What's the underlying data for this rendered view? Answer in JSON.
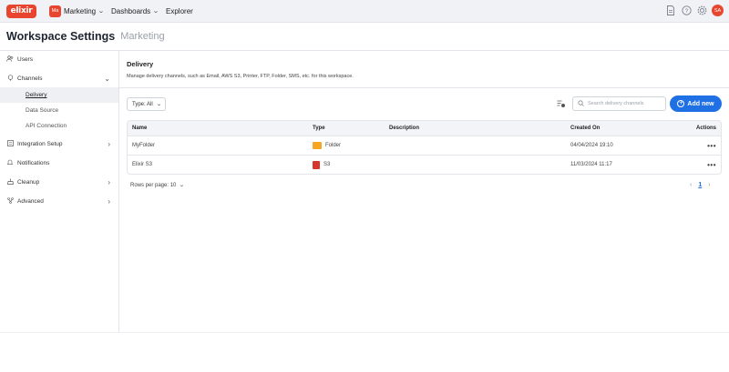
{
  "app": {
    "logo_text": "elixir",
    "brand_color": "#e8452e",
    "accent_color": "#1f6fe5"
  },
  "topbar": {
    "workspace_badge": "Ma",
    "workspace_label": "Marketing",
    "dashboards_label": "Dashboards",
    "explorer_label": "Explorer",
    "icons": [
      "report-icon",
      "help-icon",
      "settings-icon"
    ],
    "avatar_initials": "SA"
  },
  "header": {
    "title": "Workspace Settings",
    "subtitle": "Marketing"
  },
  "sidebar": {
    "items": [
      {
        "label": "Users",
        "icon": "users-icon"
      },
      {
        "label": "Channels",
        "icon": "channels-icon"
      },
      {
        "label": "Integration Setup",
        "icon": "integration-icon"
      },
      {
        "label": "Notifications",
        "icon": "bell-icon"
      },
      {
        "label": "Cleanup",
        "icon": "broom-icon"
      },
      {
        "label": "Advanced",
        "icon": "advanced-icon"
      }
    ],
    "channels_sub": [
      "Delivery",
      "Data Source",
      "API Connection"
    ]
  },
  "main": {
    "section_title": "Delivery",
    "section_desc": "Manage delivery channels, such as Email, AWS S3, Printer, FTP, Folder, SMS, etc. for this workspace.",
    "type_filter": "Type: All",
    "search_placeholder": "Search delivery channels",
    "add_button": "Add new",
    "columns": {
      "name": "Name",
      "type": "Type",
      "description": "Description",
      "created_on": "Created On",
      "actions": "Actions"
    },
    "rows": [
      {
        "name": "MyFolder",
        "type": "Folder",
        "description": "",
        "created_on": "04/04/2024 19:10",
        "actions": "•••"
      },
      {
        "name": "Elixir S3",
        "type": "S3",
        "description": "",
        "created_on": "11/03/2024 11:17",
        "actions": "•••"
      }
    ],
    "rows_per_page_label": "Rows per page: 10",
    "current_page": "1"
  }
}
